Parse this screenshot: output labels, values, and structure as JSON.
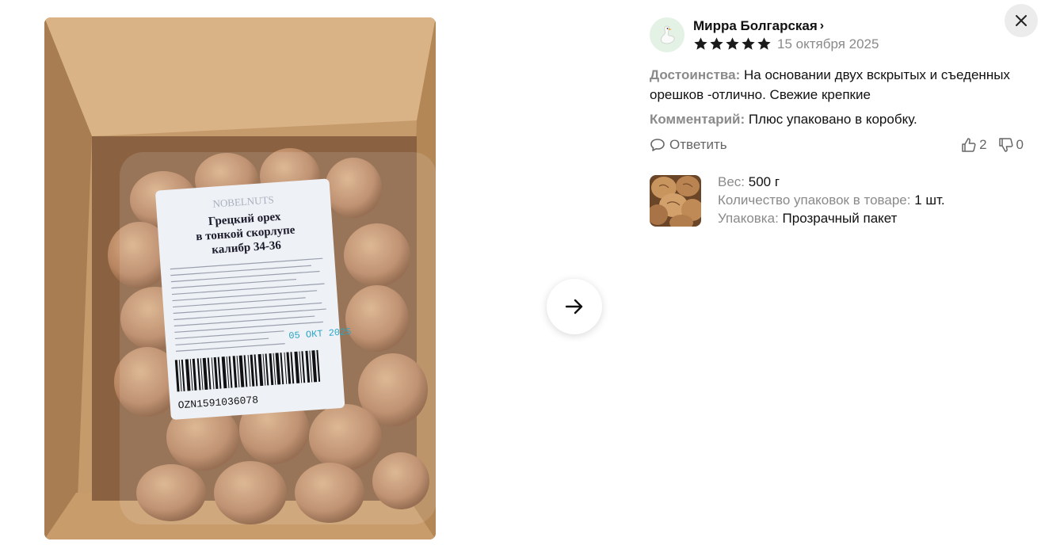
{
  "photo": {
    "label_brand": "NOBELNUTS",
    "label_title_1": "Грецкий орех",
    "label_title_2": "в тонкой скорлупе",
    "label_title_3": "калибр 34-36",
    "label_date_stamp": "05 ОКТ 2025",
    "barcode_text": "OZN1591036078"
  },
  "review": {
    "author": "Мирра Болгарская",
    "rating": 5,
    "date": "15 октября 2025",
    "advantages_label": "Достоинства:",
    "advantages_text": "На основании двух вскрытых и съеденных орешков -отлично. Свежие крепкие",
    "comment_label": "Комментарий:",
    "comment_text": "Плюс упаковано в коробку.",
    "reply_label": "Ответить",
    "likes": "2",
    "dislikes": "0"
  },
  "product": {
    "weight_label": "Вес:",
    "weight_value": "500 г",
    "qty_label": "Количество упаковок в товаре:",
    "qty_value": "1 шт.",
    "pack_label": "Упаковка:",
    "pack_value": "Прозрачный пакет"
  },
  "colors": {
    "accent": "#111111",
    "muted": "#8a8a8a",
    "avatar_bg": "#e3f2e4"
  },
  "icons": {
    "next": "arrow-right-icon",
    "close": "close-icon",
    "reply": "chat-bubble-icon",
    "like": "thumb-up-icon",
    "dislike": "thumb-down-icon"
  }
}
